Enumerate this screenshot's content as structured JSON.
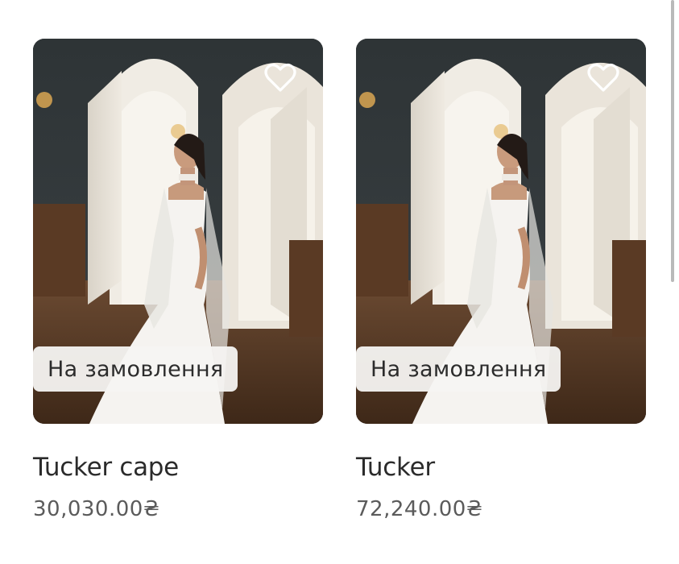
{
  "products": [
    {
      "name": "Tucker cape",
      "price": "30,030.00₴",
      "badge": "На замовлення",
      "favorite_icon": "heart-outline-icon"
    },
    {
      "name": "Tucker",
      "price": "72,240.00₴",
      "badge": "На замовлення",
      "favorite_icon": "heart-outline-icon"
    }
  ],
  "colors": {
    "name_text": "#2b2b2b",
    "price_text": "#5b5b5b",
    "badge_bg": "#f6f4f2",
    "heart_stroke": "#ffffff"
  }
}
